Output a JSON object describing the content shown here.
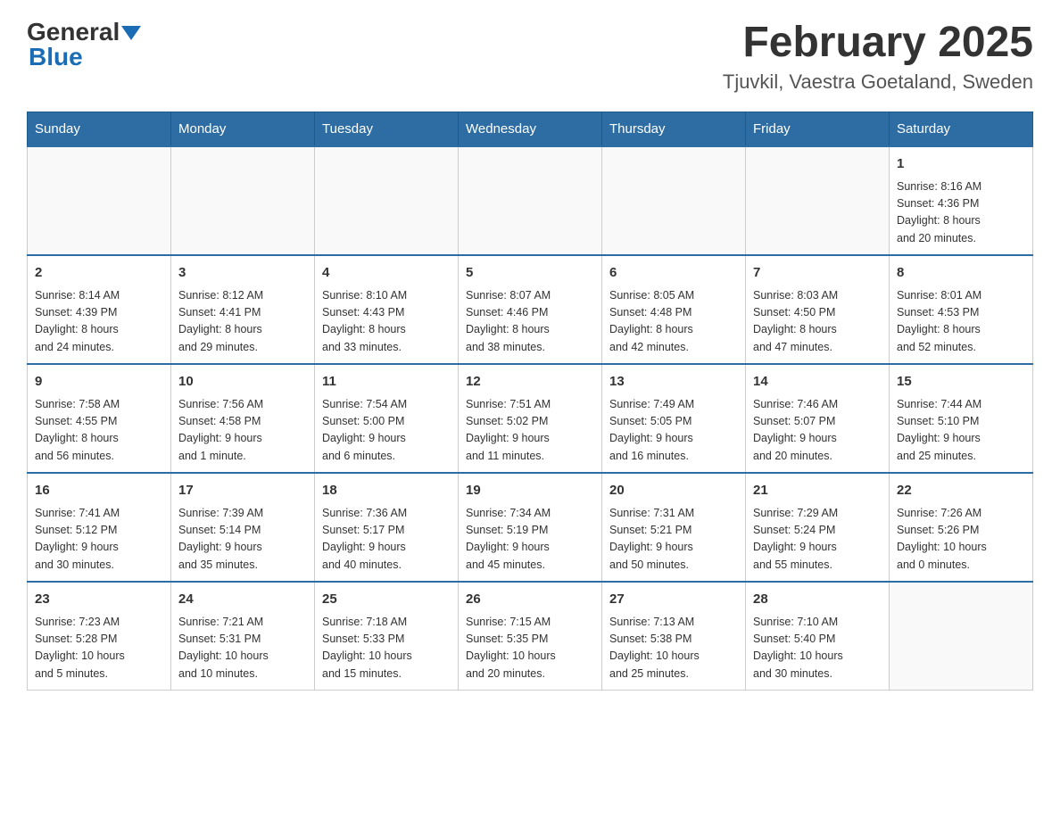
{
  "header": {
    "logo_general": "General",
    "logo_blue": "Blue",
    "title": "February 2025",
    "subtitle": "Tjuvkil, Vaestra Goetaland, Sweden"
  },
  "weekdays": [
    "Sunday",
    "Monday",
    "Tuesday",
    "Wednesday",
    "Thursday",
    "Friday",
    "Saturday"
  ],
  "weeks": [
    [
      {
        "day": "",
        "info": ""
      },
      {
        "day": "",
        "info": ""
      },
      {
        "day": "",
        "info": ""
      },
      {
        "day": "",
        "info": ""
      },
      {
        "day": "",
        "info": ""
      },
      {
        "day": "",
        "info": ""
      },
      {
        "day": "1",
        "info": "Sunrise: 8:16 AM\nSunset: 4:36 PM\nDaylight: 8 hours\nand 20 minutes."
      }
    ],
    [
      {
        "day": "2",
        "info": "Sunrise: 8:14 AM\nSunset: 4:39 PM\nDaylight: 8 hours\nand 24 minutes."
      },
      {
        "day": "3",
        "info": "Sunrise: 8:12 AM\nSunset: 4:41 PM\nDaylight: 8 hours\nand 29 minutes."
      },
      {
        "day": "4",
        "info": "Sunrise: 8:10 AM\nSunset: 4:43 PM\nDaylight: 8 hours\nand 33 minutes."
      },
      {
        "day": "5",
        "info": "Sunrise: 8:07 AM\nSunset: 4:46 PM\nDaylight: 8 hours\nand 38 minutes."
      },
      {
        "day": "6",
        "info": "Sunrise: 8:05 AM\nSunset: 4:48 PM\nDaylight: 8 hours\nand 42 minutes."
      },
      {
        "day": "7",
        "info": "Sunrise: 8:03 AM\nSunset: 4:50 PM\nDaylight: 8 hours\nand 47 minutes."
      },
      {
        "day": "8",
        "info": "Sunrise: 8:01 AM\nSunset: 4:53 PM\nDaylight: 8 hours\nand 52 minutes."
      }
    ],
    [
      {
        "day": "9",
        "info": "Sunrise: 7:58 AM\nSunset: 4:55 PM\nDaylight: 8 hours\nand 56 minutes."
      },
      {
        "day": "10",
        "info": "Sunrise: 7:56 AM\nSunset: 4:58 PM\nDaylight: 9 hours\nand 1 minute."
      },
      {
        "day": "11",
        "info": "Sunrise: 7:54 AM\nSunset: 5:00 PM\nDaylight: 9 hours\nand 6 minutes."
      },
      {
        "day": "12",
        "info": "Sunrise: 7:51 AM\nSunset: 5:02 PM\nDaylight: 9 hours\nand 11 minutes."
      },
      {
        "day": "13",
        "info": "Sunrise: 7:49 AM\nSunset: 5:05 PM\nDaylight: 9 hours\nand 16 minutes."
      },
      {
        "day": "14",
        "info": "Sunrise: 7:46 AM\nSunset: 5:07 PM\nDaylight: 9 hours\nand 20 minutes."
      },
      {
        "day": "15",
        "info": "Sunrise: 7:44 AM\nSunset: 5:10 PM\nDaylight: 9 hours\nand 25 minutes."
      }
    ],
    [
      {
        "day": "16",
        "info": "Sunrise: 7:41 AM\nSunset: 5:12 PM\nDaylight: 9 hours\nand 30 minutes."
      },
      {
        "day": "17",
        "info": "Sunrise: 7:39 AM\nSunset: 5:14 PM\nDaylight: 9 hours\nand 35 minutes."
      },
      {
        "day": "18",
        "info": "Sunrise: 7:36 AM\nSunset: 5:17 PM\nDaylight: 9 hours\nand 40 minutes."
      },
      {
        "day": "19",
        "info": "Sunrise: 7:34 AM\nSunset: 5:19 PM\nDaylight: 9 hours\nand 45 minutes."
      },
      {
        "day": "20",
        "info": "Sunrise: 7:31 AM\nSunset: 5:21 PM\nDaylight: 9 hours\nand 50 minutes."
      },
      {
        "day": "21",
        "info": "Sunrise: 7:29 AM\nSunset: 5:24 PM\nDaylight: 9 hours\nand 55 minutes."
      },
      {
        "day": "22",
        "info": "Sunrise: 7:26 AM\nSunset: 5:26 PM\nDaylight: 10 hours\nand 0 minutes."
      }
    ],
    [
      {
        "day": "23",
        "info": "Sunrise: 7:23 AM\nSunset: 5:28 PM\nDaylight: 10 hours\nand 5 minutes."
      },
      {
        "day": "24",
        "info": "Sunrise: 7:21 AM\nSunset: 5:31 PM\nDaylight: 10 hours\nand 10 minutes."
      },
      {
        "day": "25",
        "info": "Sunrise: 7:18 AM\nSunset: 5:33 PM\nDaylight: 10 hours\nand 15 minutes."
      },
      {
        "day": "26",
        "info": "Sunrise: 7:15 AM\nSunset: 5:35 PM\nDaylight: 10 hours\nand 20 minutes."
      },
      {
        "day": "27",
        "info": "Sunrise: 7:13 AM\nSunset: 5:38 PM\nDaylight: 10 hours\nand 25 minutes."
      },
      {
        "day": "28",
        "info": "Sunrise: 7:10 AM\nSunset: 5:40 PM\nDaylight: 10 hours\nand 30 minutes."
      },
      {
        "day": "",
        "info": ""
      }
    ]
  ]
}
